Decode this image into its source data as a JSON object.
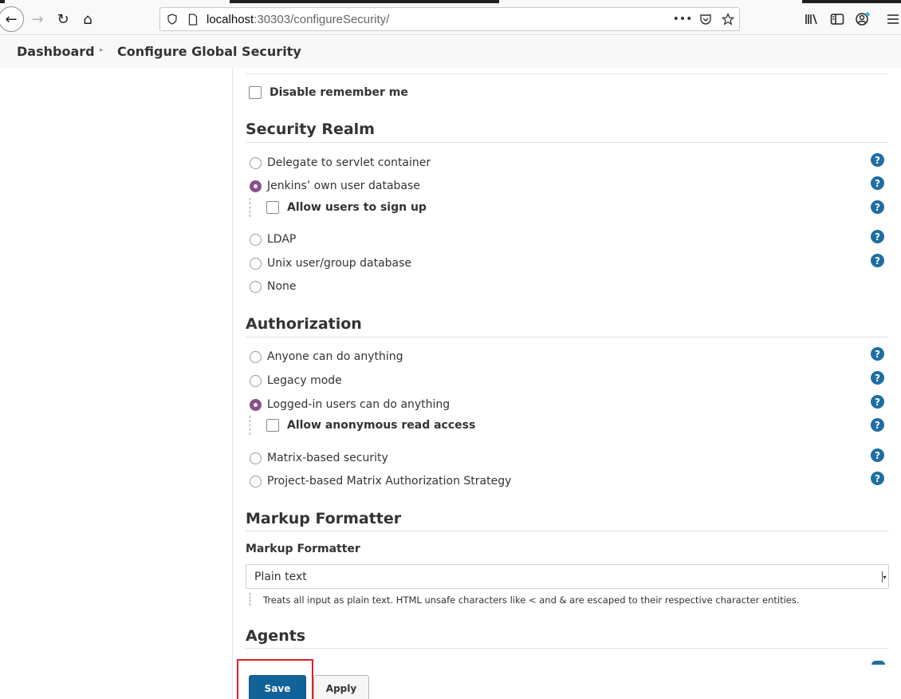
{
  "browser": {
    "url_host": "localhost",
    "url_path": ":30303/configureSecurity/",
    "icons": [
      "back-icon",
      "forward-icon",
      "reload-icon",
      "home-icon",
      "shield-icon",
      "page-icon",
      "more-icon",
      "pocket-icon",
      "star-icon",
      "library-icon",
      "sidebar-icon",
      "account-icon",
      "menu-icon"
    ]
  },
  "breadcrumb": {
    "home": "Dashboard",
    "separator": "▸",
    "current": "Configure Global Security"
  },
  "top_options": {
    "disable_remember_me": "Disable remember me"
  },
  "security_realm": {
    "title": "Security Realm",
    "options": [
      "Delegate to servlet container",
      "Jenkins’ own user database",
      "LDAP",
      "Unix user/group database",
      "None"
    ],
    "selected": "Jenkins’ own user database",
    "allow_signup": "Allow users to sign up"
  },
  "authorization": {
    "title": "Authorization",
    "options": [
      "Anyone can do anything",
      "Legacy mode",
      "Logged-in users can do anything",
      "Matrix-based security",
      "Project-based Matrix Authorization Strategy"
    ],
    "selected": "Logged-in users can do anything",
    "allow_anonymous": "Allow anonymous read access"
  },
  "markup_formatter": {
    "title": "Markup Formatter",
    "field_label": "Markup Formatter",
    "value": "Plain text",
    "description": "Treats all input as plain text. HTML unsafe characters like < and & are escaped to their respective character entities."
  },
  "agents": {
    "title": "Agents"
  },
  "buttons": {
    "save": "Save",
    "apply": "Apply"
  },
  "help_glyph": "?",
  "colors": {
    "radio_selected": "#8a4f8f",
    "help_icon": "#1e6ea3",
    "save_button": "#116299",
    "highlight": "#e0202a"
  }
}
